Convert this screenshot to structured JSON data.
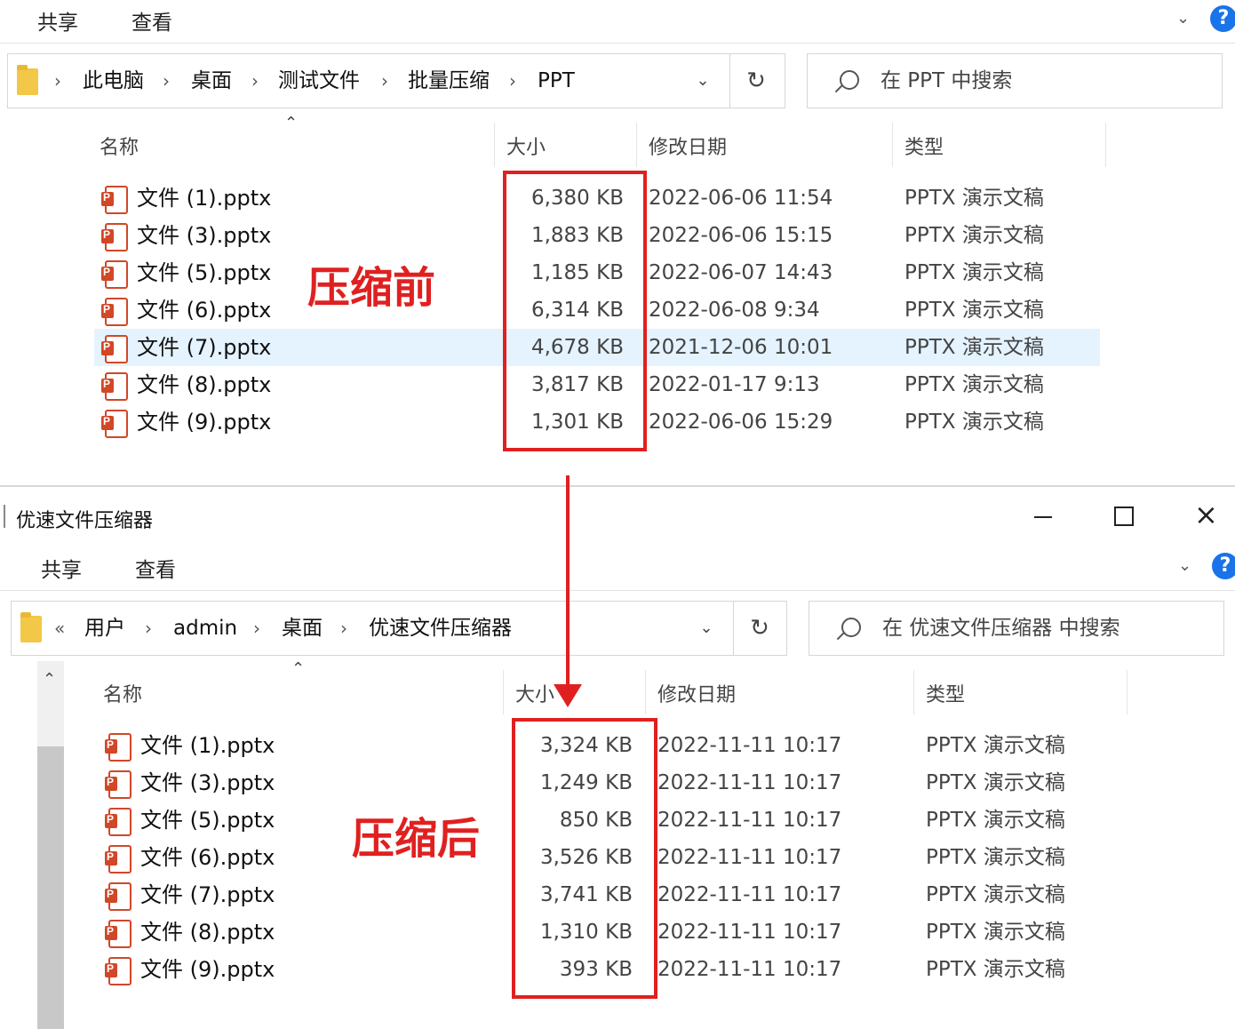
{
  "top": {
    "ribbon": {
      "share": "共享",
      "view": "查看"
    },
    "breadcrumb": [
      "此电脑",
      "桌面",
      "测试文件",
      "批量压缩",
      "PPT"
    ],
    "search_placeholder": "在 PPT 中搜索",
    "columns": {
      "name": "名称",
      "size": "大小",
      "date": "修改日期",
      "type": "类型"
    },
    "files": [
      {
        "name": "文件 (1).pptx",
        "size": "6,380 KB",
        "date": "2022-06-06 11:54",
        "type": "PPTX 演示文稿"
      },
      {
        "name": "文件 (3).pptx",
        "size": "1,883 KB",
        "date": "2022-06-06 15:15",
        "type": "PPTX 演示文稿"
      },
      {
        "name": "文件 (5).pptx",
        "size": "1,185 KB",
        "date": "2022-06-07 14:43",
        "type": "PPTX 演示文稿"
      },
      {
        "name": "文件 (6).pptx",
        "size": "6,314 KB",
        "date": "2022-06-08 9:34",
        "type": "PPTX 演示文稿"
      },
      {
        "name": "文件 (7).pptx",
        "size": "4,678 KB",
        "date": "2021-12-06 10:01",
        "type": "PPTX 演示文稿",
        "selected": true
      },
      {
        "name": "文件 (8).pptx",
        "size": "3,817 KB",
        "date": "2022-01-17 9:13",
        "type": "PPTX 演示文稿"
      },
      {
        "name": "文件 (9).pptx",
        "size": "1,301 KB",
        "date": "2022-06-06 15:29",
        "type": "PPTX 演示文稿"
      }
    ],
    "annotation": "压缩前"
  },
  "bottom": {
    "title": "优速文件压缩器",
    "ribbon": {
      "share": "共享",
      "view": "查看"
    },
    "breadcrumb_prefix": "«",
    "breadcrumb": [
      "用户",
      "admin",
      "桌面",
      "优速文件压缩器"
    ],
    "search_placeholder": "在 优速文件压缩器 中搜索",
    "columns": {
      "name": "名称",
      "size": "大小",
      "date": "修改日期",
      "type": "类型"
    },
    "files": [
      {
        "name": "文件 (1).pptx",
        "size": "3,324 KB",
        "date": "2022-11-11 10:17",
        "type": "PPTX 演示文稿"
      },
      {
        "name": "文件 (3).pptx",
        "size": "1,249 KB",
        "date": "2022-11-11 10:17",
        "type": "PPTX 演示文稿"
      },
      {
        "name": "文件 (5).pptx",
        "size": "850 KB",
        "date": "2022-11-11 10:17",
        "type": "PPTX 演示文稿"
      },
      {
        "name": "文件 (6).pptx",
        "size": "3,526 KB",
        "date": "2022-11-11 10:17",
        "type": "PPTX 演示文稿"
      },
      {
        "name": "文件 (7).pptx",
        "size": "3,741 KB",
        "date": "2022-11-11 10:17",
        "type": "PPTX 演示文稿"
      },
      {
        "name": "文件 (8).pptx",
        "size": "1,310 KB",
        "date": "2022-11-11 10:17",
        "type": "PPTX 演示文稿"
      },
      {
        "name": "文件 (9).pptx",
        "size": "393 KB",
        "date": "2022-11-11 10:17",
        "type": "PPTX 演示文稿"
      }
    ],
    "annotation": "压缩后"
  },
  "icons": {
    "folder": "folder-icon",
    "file": "powerpoint-file-icon",
    "search": "search-icon",
    "refresh": "refresh-icon",
    "help": "help-icon"
  },
  "colors": {
    "annotation_red": "#e02020",
    "selection": "#cce8ff",
    "accent": "#1a73e8"
  }
}
